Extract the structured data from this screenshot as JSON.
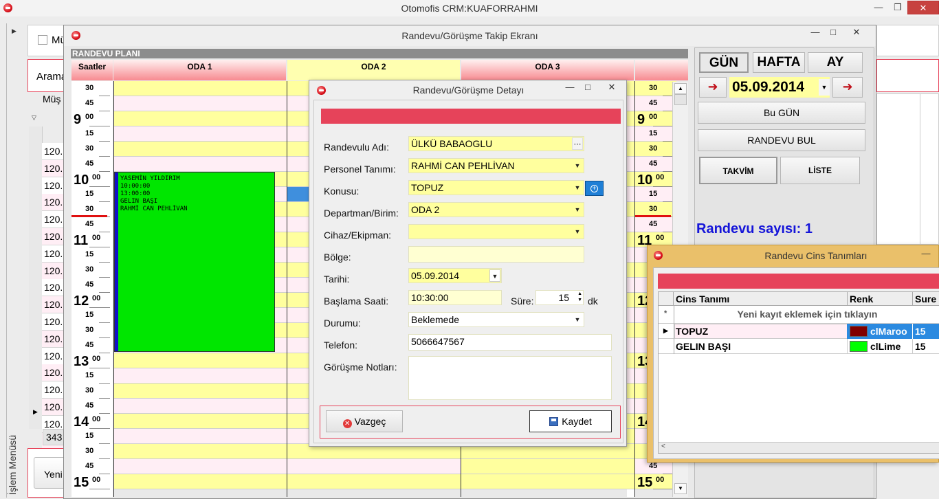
{
  "main_window": {
    "title": "Otomofis CRM:KUAFORRAHMI"
  },
  "background_form": {
    "checkbox_label": "Mü",
    "search_label": "Arama",
    "col_header": "Müş",
    "rows": [
      "120.",
      "120.",
      "120.",
      "120.",
      "120.",
      "120.",
      "120.",
      "120.",
      "120.",
      "120.",
      "120.",
      "120.",
      "120.",
      "120.",
      "120.",
      "120.",
      "120.",
      "120."
    ],
    "count": "343",
    "new_button": "Yeni",
    "side_menu": "İşlem Menüsü"
  },
  "tracking_window": {
    "title": "Randevu/Görüşme Takip Ekranı",
    "plan_label": "RANDEVU PLANI",
    "hours_header": "Saatler",
    "rooms": [
      "ODA 1",
      "ODA 2",
      "ODA 3"
    ],
    "appointment": {
      "customer": "YASEMİN YILDIRIM",
      "start": "10:00:00",
      "end": "13:00:00",
      "service": "GELIN BAŞI",
      "staff": "RAHMİ CAN PEHLİVAN",
      "color": "#00e600"
    },
    "view_buttons": {
      "day": "GÜN",
      "week": "HAFTA",
      "month": "AY"
    },
    "date": "05.09.2014",
    "today_button": "Bu GÜN",
    "find_button": "RANDEVU BUL",
    "calendar_tab": "TAKVİM",
    "list_tab": "LİSTE",
    "count_label": "Randevu sayısı: 1"
  },
  "detail_dialog": {
    "title": "Randevu/Görüşme Detayı",
    "labels": {
      "name": "Randevulu Adı:",
      "staff": "Personel Tanımı:",
      "subject": "Konusu:",
      "department": "Departman/Birim:",
      "device": "Cihaz/Ekipman:",
      "region": "Bölge:",
      "date": "Tarihi:",
      "start": "Başlama Saati:",
      "duration": "Süre:",
      "duration_unit": "dk",
      "status": "Durumu:",
      "phone": "Telefon:",
      "notes": "Görüşme Notları:"
    },
    "values": {
      "name": "ÜLKÜ BABAOGLU",
      "staff": "RAHMİ CAN PEHLİVAN",
      "subject": "TOPUZ",
      "department": "ODA 2",
      "device": "",
      "region": "",
      "date": "05.09.2014",
      "start": "10:30:00",
      "duration": "15",
      "status": "Beklemede",
      "phone": "5066647567",
      "notes": ""
    },
    "cancel_button": "Vazgeç",
    "save_button": "Kaydet"
  },
  "cins_dialog": {
    "title": "Randevu Cins Tanımları",
    "headers": [
      "Cins Tanımı",
      "Renk",
      "Sure"
    ],
    "new_row_hint": "Yeni kayıt eklemek için tıklayın",
    "rows": [
      {
        "name": "TOPUZ",
        "color_name": "clMaroo",
        "color": "#800000",
        "duration": "15"
      },
      {
        "name": "GELIN BAŞI",
        "color_name": "clLime",
        "color": "#00ff00",
        "duration": "15"
      }
    ]
  },
  "colors": {
    "accent_red": "#e6435a",
    "title_blue": "#1515d9"
  }
}
